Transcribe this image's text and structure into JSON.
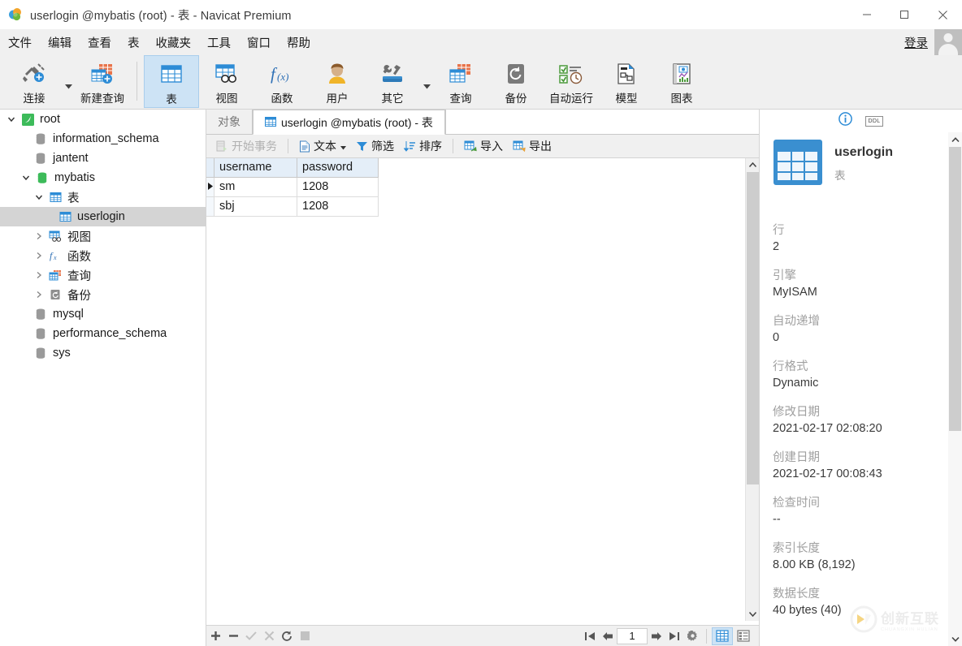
{
  "window": {
    "title": "userlogin @mybatis (root) - 表 - Navicat Premium",
    "minimize": "—",
    "maximize": "□",
    "close": "✕"
  },
  "menubar": {
    "items": [
      {
        "label": "文件"
      },
      {
        "label": "编辑"
      },
      {
        "label": "查看"
      },
      {
        "label": "表"
      },
      {
        "label": "收藏夹"
      },
      {
        "label": "工具"
      },
      {
        "label": "窗口"
      },
      {
        "label": "帮助"
      }
    ],
    "login_label": "登录"
  },
  "toolbar": {
    "items": [
      {
        "label": "连接",
        "icon": "connection-icon",
        "caret": true
      },
      {
        "label": "新建查询",
        "icon": "new-query-icon",
        "caret": false
      },
      {
        "label": "表",
        "icon": "table-icon",
        "active": true
      },
      {
        "label": "视图",
        "icon": "view-icon"
      },
      {
        "label": "函数",
        "icon": "function-icon"
      },
      {
        "label": "用户",
        "icon": "user-icon"
      },
      {
        "label": "其它",
        "icon": "other-icon",
        "caret": true
      },
      {
        "label": "查询",
        "icon": "query-icon"
      },
      {
        "label": "备份",
        "icon": "backup-icon"
      },
      {
        "label": "自动运行",
        "icon": "automation-icon"
      },
      {
        "label": "模型",
        "icon": "model-icon"
      },
      {
        "label": "图表",
        "icon": "chart-icon"
      }
    ]
  },
  "sidebar": {
    "tree": [
      {
        "label": "root",
        "icon": "connection-node-icon",
        "depth": 0,
        "twisty": "expanded"
      },
      {
        "label": "information_schema",
        "icon": "database-icon",
        "depth": 1,
        "twisty": "none"
      },
      {
        "label": "jantent",
        "icon": "database-icon",
        "depth": 1,
        "twisty": "none"
      },
      {
        "label": "mybatis",
        "icon": "database-open-icon",
        "depth": 1,
        "twisty": "expanded"
      },
      {
        "label": "表",
        "icon": "table-folder-icon",
        "depth": 2,
        "twisty": "expanded"
      },
      {
        "label": "userlogin",
        "icon": "table-icon",
        "depth": 3,
        "twisty": "none",
        "selected": true
      },
      {
        "label": "视图",
        "icon": "view-folder-icon",
        "depth": 2,
        "twisty": "collapsed"
      },
      {
        "label": "函数",
        "icon": "function-folder-icon",
        "depth": 2,
        "twisty": "collapsed"
      },
      {
        "label": "查询",
        "icon": "query-folder-icon",
        "depth": 2,
        "twisty": "collapsed"
      },
      {
        "label": "备份",
        "icon": "backup-folder-icon",
        "depth": 2,
        "twisty": "collapsed"
      },
      {
        "label": "mysql",
        "icon": "database-icon",
        "depth": 1,
        "twisty": "none"
      },
      {
        "label": "performance_schema",
        "icon": "database-icon",
        "depth": 1,
        "twisty": "none"
      },
      {
        "label": "sys",
        "icon": "database-icon",
        "depth": 1,
        "twisty": "none"
      }
    ]
  },
  "tabs": [
    {
      "label": "对象",
      "active": false,
      "icon": null
    },
    {
      "label": "userlogin @mybatis (root) - 表",
      "active": true,
      "icon": "table-icon"
    }
  ],
  "gridbar": {
    "items": [
      {
        "label": "开始事务",
        "icon": "transaction-icon",
        "disabled": true
      },
      {
        "label": "文本",
        "icon": "text-icon",
        "caret": true
      },
      {
        "label": "筛选",
        "icon": "filter-icon"
      },
      {
        "label": "排序",
        "icon": "sort-icon"
      },
      {
        "label": "导入",
        "icon": "import-icon"
      },
      {
        "label": "导出",
        "icon": "export-icon"
      }
    ]
  },
  "grid": {
    "columns": [
      "username",
      "password"
    ],
    "rows": [
      {
        "current": true,
        "cells": [
          "sm",
          "1208"
        ]
      },
      {
        "current": false,
        "cells": [
          "sbj",
          "1208"
        ]
      }
    ]
  },
  "statusbar": {
    "record_buttons": [
      {
        "name": "add-record-button",
        "glyph": "+",
        "disabled": false
      },
      {
        "name": "delete-record-button",
        "glyph": "−",
        "disabled": false
      },
      {
        "name": "apply-change-button",
        "glyph": "✓",
        "disabled": true
      },
      {
        "name": "cancel-change-button",
        "glyph": "✕",
        "disabled": true
      },
      {
        "name": "refresh-button",
        "glyph": "⟳",
        "disabled": false
      },
      {
        "name": "stop-button",
        "glyph": "■",
        "disabled": true
      }
    ],
    "page_value": "1",
    "nav_buttons": [
      {
        "name": "first-page-button",
        "glyph": "|◀"
      },
      {
        "name": "previous-page-button",
        "glyph": "◀"
      },
      {
        "name": "next-page-button",
        "glyph": "▶"
      },
      {
        "name": "last-page-button",
        "glyph": "▶|"
      },
      {
        "name": "grid-settings-button",
        "glyph": "⚙"
      }
    ],
    "view_toggles": [
      {
        "name": "grid-view-toggle",
        "active": true
      },
      {
        "name": "form-view-toggle",
        "active": false
      }
    ]
  },
  "infopanel": {
    "tools": [
      {
        "name": "info-tab-icon",
        "label": "i"
      },
      {
        "name": "ddl-tab-icon",
        "label": "DDL"
      }
    ],
    "object_name": "userlogin",
    "object_type": "表",
    "fields": [
      {
        "key": "行",
        "value": "2"
      },
      {
        "key": "引擎",
        "value": "MyISAM"
      },
      {
        "key": "自动递增",
        "value": "0"
      },
      {
        "key": "行格式",
        "value": "Dynamic"
      },
      {
        "key": "修改日期",
        "value": "2021-02-17 02:08:20"
      },
      {
        "key": "创建日期",
        "value": "2021-02-17 00:08:43"
      },
      {
        "key": "检查时间",
        "value": "--"
      },
      {
        "key": "索引长度",
        "value": "8.00 KB (8,192)"
      },
      {
        "key": "数据长度",
        "value": "40 bytes (40)"
      }
    ]
  },
  "watermark": {
    "text": "创新互联",
    "subtext": "CHUANGXIN HULIAN"
  },
  "colors": {
    "accent": "#2d8cd6",
    "active_tab_bg": "#cde3f5",
    "header_bg": "#e4eef8",
    "chrome_bg": "#f0f0f0"
  }
}
